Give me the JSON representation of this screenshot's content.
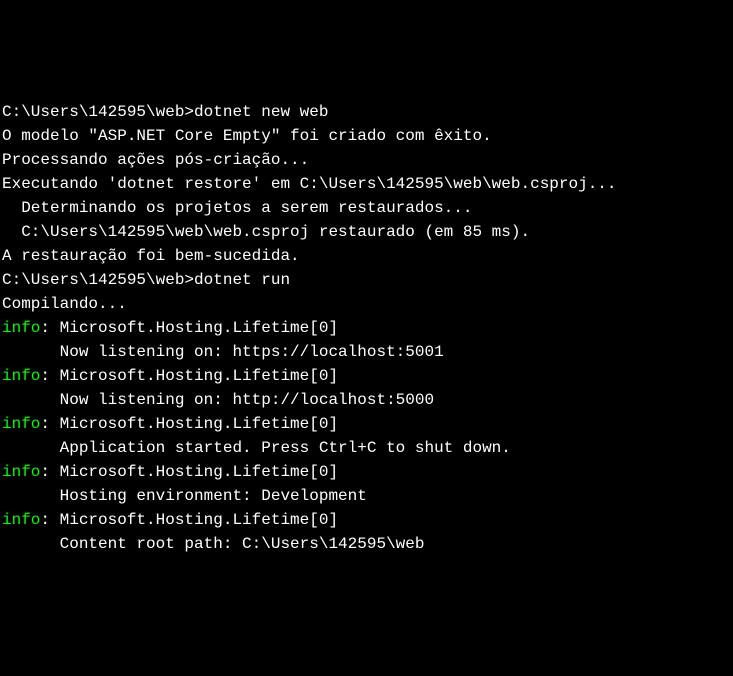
{
  "lines": {
    "prompt1_path": "C:\\Users\\142595\\web>",
    "prompt1_cmd": "dotnet new web",
    "msg1": "O modelo \"ASP.NET Core Empty\" foi criado com êxito.",
    "blank1": "",
    "msg2": "Processando ações pós-criação...",
    "msg3": "Executando 'dotnet restore' em C:\\Users\\142595\\web\\web.csproj...",
    "msg4": "  Determinando os projetos a serem restaurados...",
    "msg5": "  C:\\Users\\142595\\web\\web.csproj restaurado (em 85 ms).",
    "msg6": "A restauração foi bem-sucedida.",
    "blank2": "",
    "blank3": "",
    "prompt2_path": "C:\\Users\\142595\\web>",
    "prompt2_cmd": "dotnet run",
    "compiling": "Compilando...",
    "info_label": "info",
    "info1_main": ": Microsoft.Hosting.Lifetime[0]",
    "info1_sub": "      Now listening on: https://localhost:5001",
    "info2_main": ": Microsoft.Hosting.Lifetime[0]",
    "info2_sub": "      Now listening on: http://localhost:5000",
    "info3_main": ": Microsoft.Hosting.Lifetime[0]",
    "info3_sub": "      Application started. Press Ctrl+C to shut down.",
    "info4_main": ": Microsoft.Hosting.Lifetime[0]",
    "info4_sub": "      Hosting environment: Development",
    "info5_main": ": Microsoft.Hosting.Lifetime[0]",
    "info5_sub": "      Content root path: C:\\Users\\142595\\web"
  }
}
